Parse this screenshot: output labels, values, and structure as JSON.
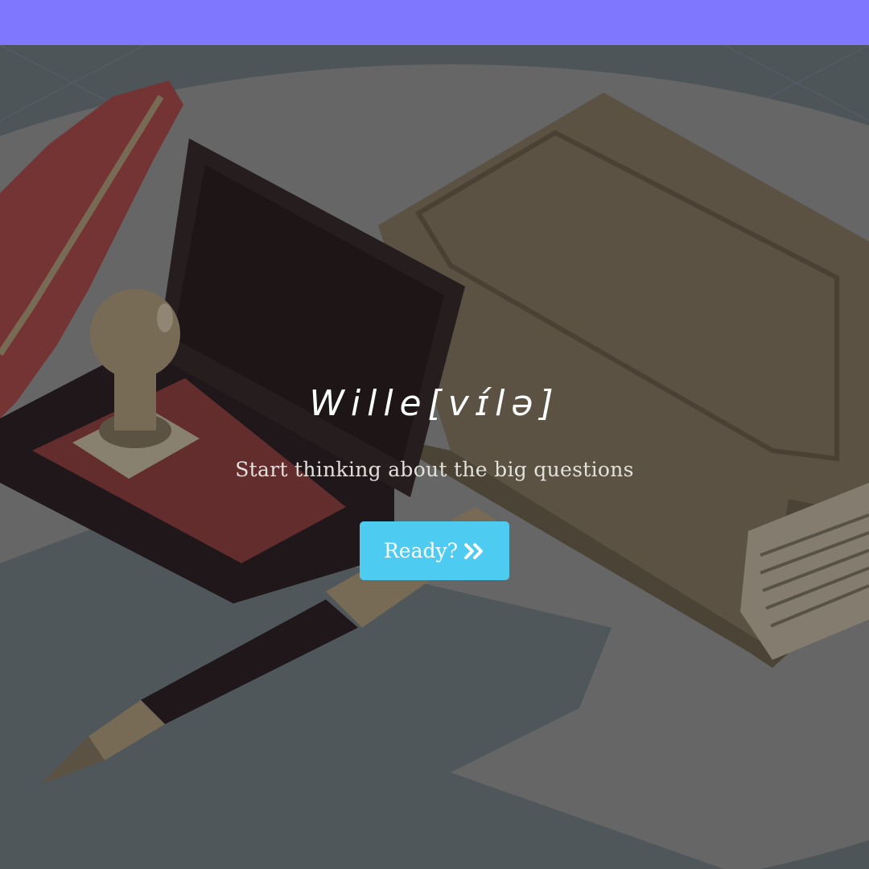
{
  "topbar": {
    "color": "#8077ff"
  },
  "hero": {
    "title": "Wille[vɪ́lə]",
    "subtitle": "Start thinking about the big questions",
    "cta_label": "Ready?",
    "cta_icon": "double-chevron-right-icon",
    "colors": {
      "overlay": "#4f575b",
      "button": "#4ecbf1",
      "book": "#5e5444",
      "stamp_box": "#1d1416",
      "ink_pad": "#662c2c",
      "quill": "#7a3333"
    }
  }
}
